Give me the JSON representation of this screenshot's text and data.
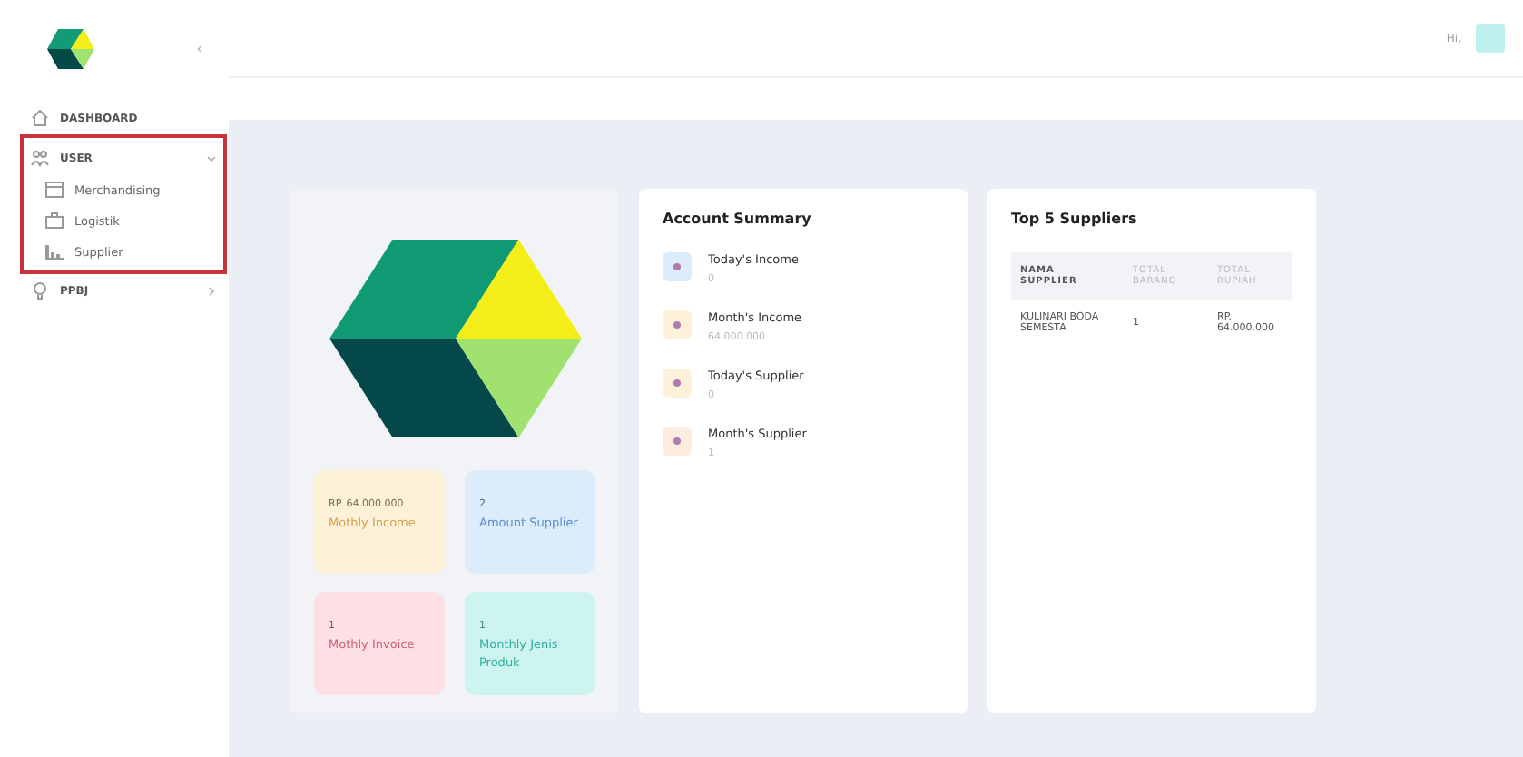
{
  "sidebar": {
    "collapse_icon": "‹",
    "items": [
      {
        "label": "DASHBOARD",
        "kind": "link"
      },
      {
        "label": "USER",
        "kind": "group",
        "expanded": true,
        "highlighted": true,
        "children": [
          {
            "label": "Merchandising"
          },
          {
            "label": "Logistik"
          },
          {
            "label": "Supplier"
          }
        ]
      },
      {
        "label": "PPBJ",
        "kind": "group",
        "expanded": false
      }
    ]
  },
  "header": {
    "greeting": "Hi,"
  },
  "stats": [
    {
      "value": "RP. 64.000.000",
      "label": "Mothly Income",
      "color": "#fdf1d9"
    },
    {
      "value": "2",
      "label": "Amount Supplier",
      "color": "#dcecfb"
    },
    {
      "value": "1",
      "label": "Mothly Invoice",
      "color": "#fde0e3"
    },
    {
      "value": "1",
      "label": "Monthly Jenis Produk",
      "color": "#cdf4ee"
    }
  ],
  "account_summary": {
    "title": "Account Summary",
    "items": [
      {
        "label": "Today's Income",
        "value": "0",
        "color": "#dcecfb"
      },
      {
        "label": "Month's Income",
        "value": "64.000.000",
        "color": "#fdf1d9"
      },
      {
        "label": "Today's Supplier",
        "value": "0",
        "color": "#fdf1d9"
      },
      {
        "label": "Month's Supplier",
        "value": "1",
        "color": "#fdece0"
      }
    ]
  },
  "top_suppliers": {
    "title": "Top 5 Suppliers",
    "columns": [
      "NAMA SUPPLIER",
      "TOTAL BARANG",
      "TOTAL RUPIAH"
    ],
    "rows": [
      [
        "KULINARI BODA SEMESTA",
        "1",
        "RP. 64.000.000"
      ]
    ]
  }
}
